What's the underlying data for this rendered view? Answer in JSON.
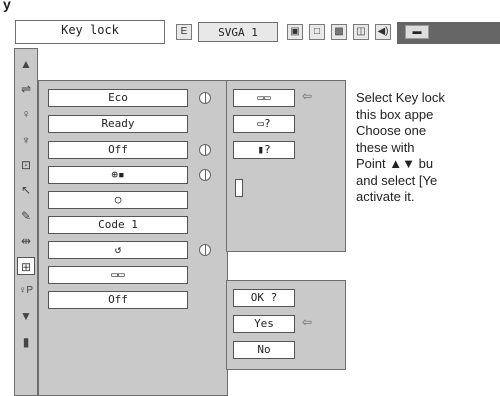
{
  "top_left_partial": "y",
  "header": {
    "title": "Key lock",
    "mode": "SVGA 1",
    "mode_icon": "E",
    "toolbar_icons": [
      "screen-icon",
      "rect-icon",
      "image-icon",
      "doc-icon",
      "speaker-icon",
      "lamp-icon"
    ]
  },
  "sidebar": {
    "items": [
      {
        "name": "scroll-up-icon",
        "glyph": "▲"
      },
      {
        "name": "link-icon",
        "glyph": "⇌"
      },
      {
        "name": "bulb-icon",
        "glyph": "♀"
      },
      {
        "name": "fan-icon",
        "glyph": "♆"
      },
      {
        "name": "monitor-icon",
        "glyph": "⊡"
      },
      {
        "name": "cursor-icon",
        "glyph": "↖"
      },
      {
        "name": "pen-icon",
        "glyph": "✎"
      },
      {
        "name": "usb-icon",
        "glyph": "⇹"
      },
      {
        "name": "lock-icon",
        "glyph": "⊞"
      },
      {
        "name": "filter-icon",
        "glyph": "♀P"
      },
      {
        "name": "scroll-down-icon",
        "glyph": "▼"
      },
      {
        "name": "door-icon",
        "glyph": "▮"
      }
    ]
  },
  "settings": [
    {
      "value": "Eco",
      "dial": true
    },
    {
      "value": "Ready",
      "dial": false
    },
    {
      "value": "Off",
      "dial": true
    },
    {
      "value": "⊕▪",
      "dial": true
    },
    {
      "value": "○",
      "dial": false
    },
    {
      "value": "Code 1",
      "dial": false
    },
    {
      "value": "↺",
      "dial": true
    },
    {
      "value": "▭▭",
      "dial": false
    },
    {
      "value": "Off",
      "dial": false
    }
  ],
  "options_top": [
    {
      "value": "▭▭",
      "arrow": "⇦"
    },
    {
      "value": "▭?"
    },
    {
      "value": "▮?"
    }
  ],
  "confirm": {
    "question": "OK ?",
    "yes": "Yes",
    "no": "No",
    "arrow": "⇦"
  },
  "description": {
    "lines": [
      "Select Key lock",
      "this box appe",
      "Choose one",
      "these with",
      "Point ▲▼ bu",
      "and select [Ye",
      "activate it."
    ]
  }
}
